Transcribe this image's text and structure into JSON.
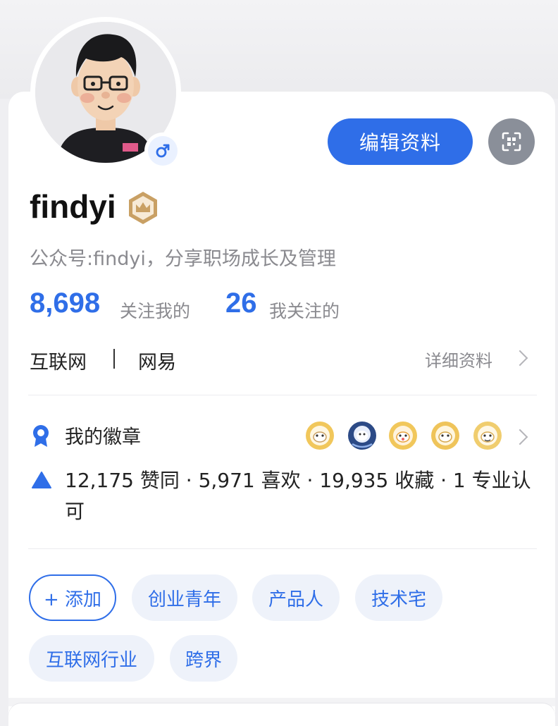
{
  "profile": {
    "username": "findyi",
    "bio": "公众号:findyi，分享职场成长及管理",
    "edit_button": "编辑资料",
    "followers_count": "8,698",
    "followers_label": "关注我的",
    "following_count": "26",
    "following_label": "我关注的",
    "industry": "互联网",
    "separator": "|",
    "company": "网易",
    "detail_link": "详细资料"
  },
  "badges": {
    "title": "我的徽章",
    "medal_icons": [
      "medal-1-icon",
      "medal-2-icon",
      "medal-3-icon",
      "medal-4-icon",
      "medal-5-icon"
    ]
  },
  "achievements": {
    "text": "12,175 赞同 · 5,971 喜欢 · 19,935 收藏 · 1 专业认可"
  },
  "tags": {
    "add_label": "+ 添加",
    "items": [
      "创业青年",
      "产品人",
      "技术宅",
      "互联网行业",
      "跨界"
    ]
  },
  "colors": {
    "accent": "#2f6ee8",
    "muted_text": "#8a8a8f",
    "tag_bg": "#eef2fa",
    "qr_button_bg": "#8a8f99",
    "crown_badge": "#c9a064"
  }
}
